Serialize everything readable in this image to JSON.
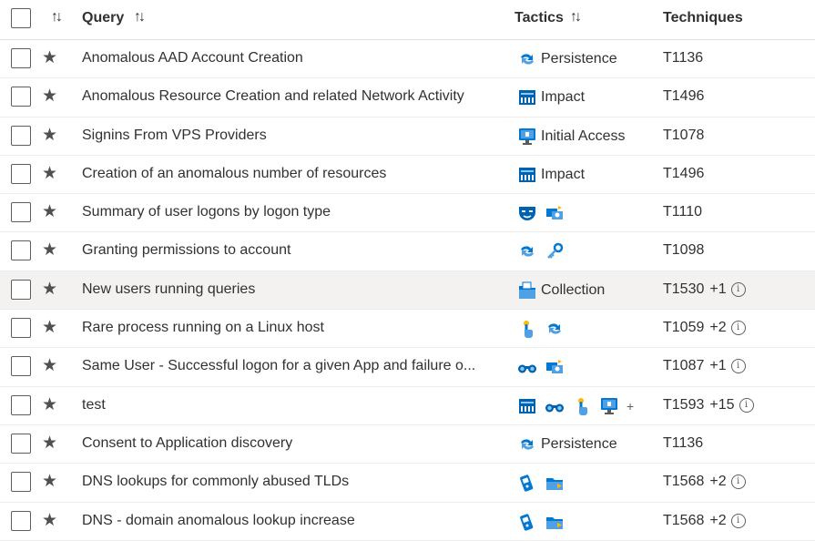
{
  "header": {
    "query_label": "Query",
    "tactics_label": "Tactics",
    "techniques_label": "Techniques",
    "sort_icon": "sort-icon"
  },
  "rows": [
    {
      "query": "Anomalous AAD Account Creation",
      "tactics": [
        "persistence"
      ],
      "tactic_label": "Persistence",
      "technique": "T1136",
      "more": ""
    },
    {
      "query": "Anomalous Resource Creation and related Network Activity",
      "tactics": [
        "impact"
      ],
      "tactic_label": "Impact",
      "technique": "T1496",
      "more": ""
    },
    {
      "query": "Signins From VPS Providers",
      "tactics": [
        "initial-access"
      ],
      "tactic_label": "Initial Access",
      "technique": "T1078",
      "more": ""
    },
    {
      "query": "Creation of an anomalous number of resources",
      "tactics": [
        "impact"
      ],
      "tactic_label": "Impact",
      "technique": "T1496",
      "more": ""
    },
    {
      "query": "Summary of user logons by logon type",
      "tactics": [
        "defense-evasion",
        "lateral-movement"
      ],
      "tactic_label": "",
      "technique": "T1110",
      "more": ""
    },
    {
      "query": "Granting permissions to account",
      "tactics": [
        "persistence",
        "credential-access"
      ],
      "tactic_label": "",
      "technique": "T1098",
      "more": ""
    },
    {
      "query": "New users running queries",
      "tactics": [
        "collection"
      ],
      "tactic_label": "Collection",
      "technique": "T1530",
      "more": "+1"
    },
    {
      "query": "Rare process running on a Linux host",
      "tactics": [
        "execution",
        "persistence"
      ],
      "tactic_label": "",
      "technique": "T1059",
      "more": "+2"
    },
    {
      "query": "Same User - Successful logon for a given App and failure o...",
      "tactics": [
        "discovery",
        "lateral-movement"
      ],
      "tactic_label": "",
      "technique": "T1087",
      "more": "+1"
    },
    {
      "query": "test",
      "tactics": [
        "impact",
        "discovery",
        "execution",
        "initial-access"
      ],
      "tactic_label": "",
      "tactic_overflow": "+",
      "technique": "T1593",
      "more": "+15"
    },
    {
      "query": "Consent to Application discovery",
      "tactics": [
        "persistence"
      ],
      "tactic_label": "Persistence",
      "technique": "T1136",
      "more": ""
    },
    {
      "query": "DNS lookups for commonly abused TLDs",
      "tactics": [
        "command-and-control",
        "exfiltration"
      ],
      "tactic_label": "",
      "technique": "T1568",
      "more": "+2"
    },
    {
      "query": "DNS - domain anomalous lookup increase",
      "tactics": [
        "command-and-control",
        "exfiltration"
      ],
      "tactic_label": "",
      "technique": "T1568",
      "more": "+2"
    }
  ],
  "selected_row": 6,
  "info_icon_glyph": "i",
  "colors": {
    "accent": "#0078d4",
    "selected_bg": "#f3f2f1",
    "border": "#ececec"
  }
}
